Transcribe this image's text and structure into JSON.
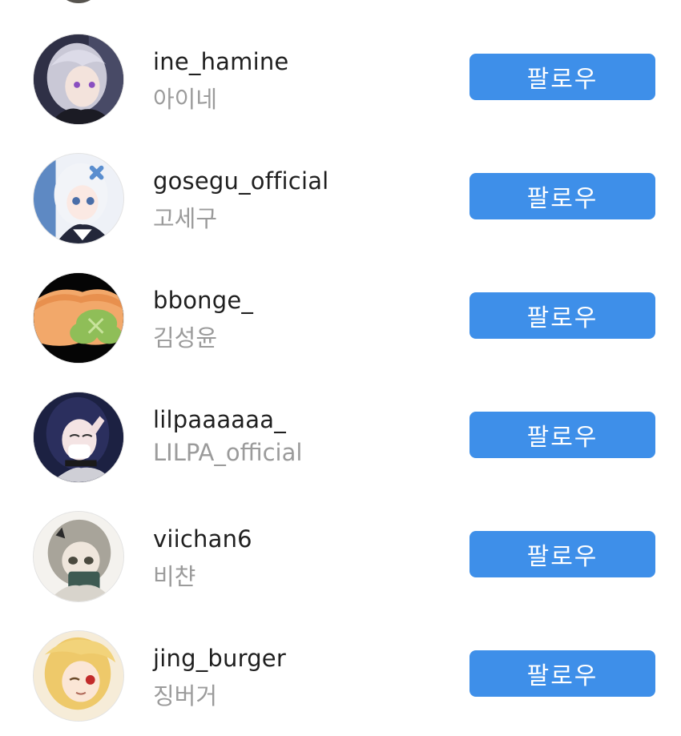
{
  "accounts": [
    {
      "username": "ine_hamine",
      "display_name": "아이네",
      "button_label": "팔로우",
      "avatar": "silver-hair-character-avatar"
    },
    {
      "username": "gosegu_official",
      "display_name": "고세구",
      "button_label": "팔로우",
      "avatar": "white-hair-character-avatar"
    },
    {
      "username": "bbonge_",
      "display_name": "김성윤",
      "button_label": "팔로우",
      "avatar": "toast-clover-avatar"
    },
    {
      "username": "lilpaaaaaa_",
      "display_name": "LILPA_official",
      "button_label": "팔로우",
      "avatar": "dark-hair-masked-character-avatar"
    },
    {
      "username": "viichan6",
      "display_name": "비챤",
      "button_label": "팔로우",
      "avatar": "sketch-character-avatar"
    },
    {
      "username": "jing_burger",
      "display_name": "징버거",
      "button_label": "팔로우",
      "avatar": "blonde-character-avatar"
    }
  ],
  "colors": {
    "follow_button": "#3e8fe9",
    "username_text": "#1f1f1f",
    "display_name_text": "#9b9b9b",
    "background": "#ffffff"
  }
}
